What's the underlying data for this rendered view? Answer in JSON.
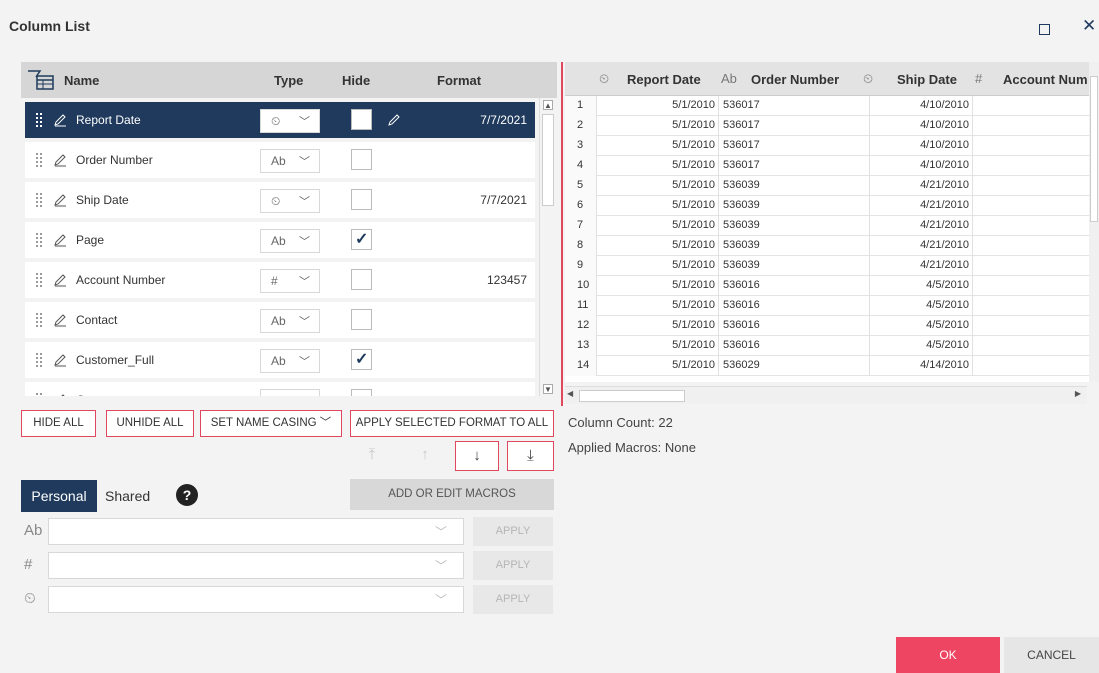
{
  "dialog": {
    "title": "Column List"
  },
  "columns_header": {
    "name": "Name",
    "type": "Type",
    "hide": "Hide",
    "format": "Format"
  },
  "rows": [
    {
      "name": "Report Date",
      "type_glyph": "⏲",
      "hidden": false,
      "format": "7/7/2021",
      "selected": true
    },
    {
      "name": "Order Number",
      "type_glyph": "Ab",
      "hidden": false,
      "format": "",
      "selected": false
    },
    {
      "name": "Ship Date",
      "type_glyph": "⏲",
      "hidden": false,
      "format": "7/7/2021",
      "selected": false
    },
    {
      "name": "Page",
      "type_glyph": "Ab",
      "hidden": true,
      "format": "",
      "selected": false
    },
    {
      "name": "Account Number",
      "type_glyph": "#",
      "hidden": false,
      "format": "123457",
      "selected": false
    },
    {
      "name": "Contact",
      "type_glyph": "Ab",
      "hidden": false,
      "format": "",
      "selected": false
    },
    {
      "name": "Customer_Full",
      "type_glyph": "Ab",
      "hidden": true,
      "format": "",
      "selected": false
    },
    {
      "name": "C...",
      "type_glyph": "Ab",
      "hidden": false,
      "format": "",
      "selected": false
    }
  ],
  "buttons": {
    "hide_all": "HIDE ALL",
    "unhide_all": "UNHIDE ALL",
    "set_name_casing": "SET NAME CASING",
    "apply_format": "APPLY SELECTED FORMAT TO ALL",
    "add_edit_macros": "ADD OR EDIT MACROS",
    "ok": "OK",
    "cancel": "CANCEL"
  },
  "tabs": {
    "personal": "Personal",
    "shared": "Shared"
  },
  "macro_rows": [
    {
      "type_glyph": "Ab",
      "apply": "APPLY"
    },
    {
      "type_glyph": "#",
      "apply": "APPLY"
    },
    {
      "type_glyph": "⏲",
      "apply": "APPLY"
    }
  ],
  "grid": {
    "headers": [
      {
        "icon": "⏲",
        "label": "Report Date"
      },
      {
        "icon": "Ab",
        "label": "Order Number"
      },
      {
        "icon": "⏲",
        "label": "Ship Date"
      },
      {
        "icon": "#",
        "label": "Account Num"
      }
    ],
    "rows": [
      [
        "1",
        "5/1/2010",
        "536017",
        "4/10/2010"
      ],
      [
        "2",
        "5/1/2010",
        "536017",
        "4/10/2010"
      ],
      [
        "3",
        "5/1/2010",
        "536017",
        "4/10/2010"
      ],
      [
        "4",
        "5/1/2010",
        "536017",
        "4/10/2010"
      ],
      [
        "5",
        "5/1/2010",
        "536039",
        "4/21/2010"
      ],
      [
        "6",
        "5/1/2010",
        "536039",
        "4/21/2010"
      ],
      [
        "7",
        "5/1/2010",
        "536039",
        "4/21/2010"
      ],
      [
        "8",
        "5/1/2010",
        "536039",
        "4/21/2010"
      ],
      [
        "9",
        "5/1/2010",
        "536039",
        "4/21/2010"
      ],
      [
        "10",
        "5/1/2010",
        "536016",
        "4/5/2010"
      ],
      [
        "11",
        "5/1/2010",
        "536016",
        "4/5/2010"
      ],
      [
        "12",
        "5/1/2010",
        "536016",
        "4/5/2010"
      ],
      [
        "13",
        "5/1/2010",
        "536016",
        "4/5/2010"
      ],
      [
        "14",
        "5/1/2010",
        "536029",
        "4/14/2010"
      ]
    ]
  },
  "info": {
    "column_count_label": "Column Count:",
    "column_count": "22",
    "applied_macros_label": "Applied Macros:",
    "applied_macros": "None"
  },
  "colors": {
    "accent": "#ee4662",
    "navy": "#1f3a5c"
  }
}
